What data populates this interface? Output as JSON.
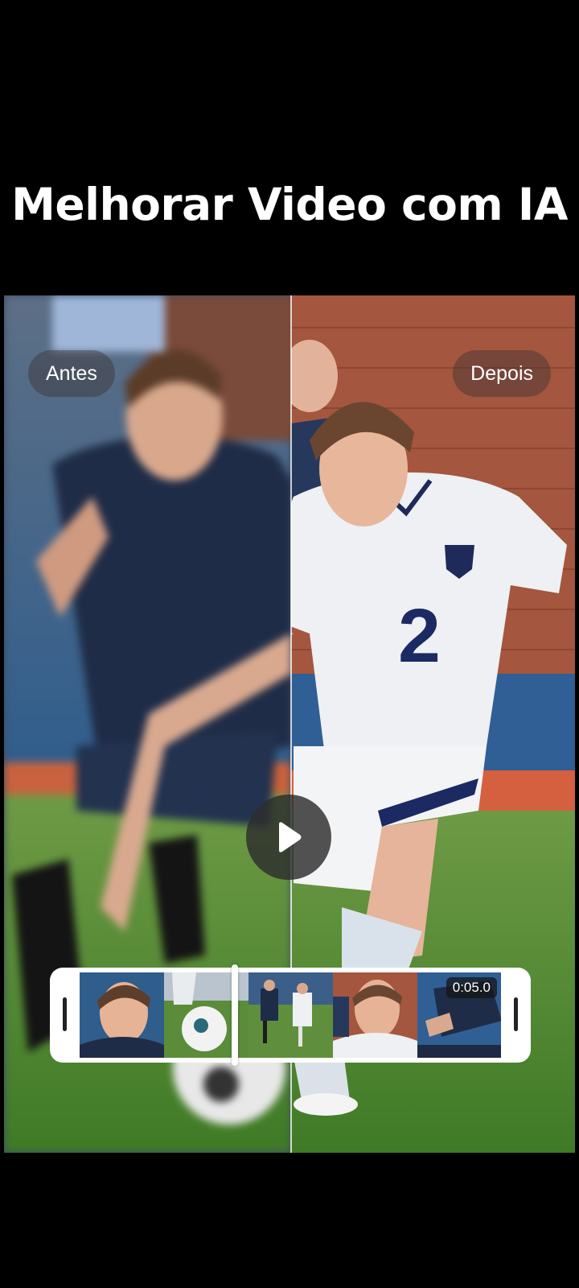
{
  "header": {
    "title": "Melhorar Video com IA"
  },
  "comparison": {
    "before_label": "Antes",
    "after_label": "Depois"
  },
  "player": {
    "play_icon": "play-icon",
    "timestamp": "0:05.0"
  },
  "after_scene": {
    "jersey_number": "2"
  },
  "colors": {
    "background": "#000000",
    "grass": "#4f8a32",
    "track": "#c9553a",
    "navy_kit": "#1e2a44",
    "white_kit": "#eef0f3"
  }
}
